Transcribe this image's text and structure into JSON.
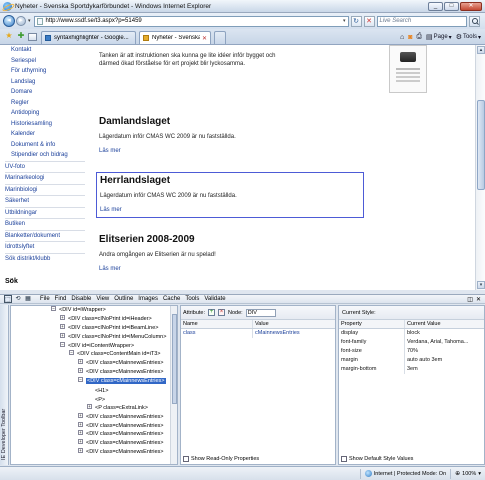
{
  "window": {
    "title": "Nyheter - Svenska Sportdykarförbundet - Windows Internet Explorer",
    "minimize": "_",
    "maximize": "□",
    "close": "✕"
  },
  "address": {
    "url": "http://www.ssdf.se/t3.aspx?p=51459",
    "search_placeholder": "Live Search"
  },
  "tabs": [
    {
      "label": "syntaxhighlighter - Google...",
      "active": false
    },
    {
      "label": "Nyheter - Svenska Spor...",
      "active": true
    }
  ],
  "command_bar": {
    "page": "Page",
    "tools": "Tools"
  },
  "sidebar": {
    "items": [
      {
        "label": "Kontakt",
        "sub": true
      },
      {
        "label": "Seriespel",
        "sub": true
      },
      {
        "label": "För uthyrning",
        "sub": true
      },
      {
        "label": "Landslag",
        "sub": true
      },
      {
        "label": "Domare",
        "sub": true
      },
      {
        "label": "Regler",
        "sub": true
      },
      {
        "label": "Antidoping",
        "sub": true
      },
      {
        "label": "Historiesamling",
        "sub": true
      },
      {
        "label": "Kalender",
        "sub": true
      },
      {
        "label": "Dokument & info",
        "sub": true
      },
      {
        "label": "Stipendier och bidrag",
        "sub": true
      },
      {
        "label": "UV-foto",
        "sub": false
      },
      {
        "label": "Marinarkeologi",
        "sub": false
      },
      {
        "label": "Marinbiologi",
        "sub": false
      },
      {
        "label": "Säkerhet",
        "sub": false
      },
      {
        "label": "Utbildningar",
        "sub": false
      },
      {
        "label": "Butiken",
        "sub": false
      },
      {
        "label": "Blanketter/dokument",
        "sub": false
      },
      {
        "label": "Idrottslyftet",
        "sub": false
      },
      {
        "label": "Sök distrikt/klubb",
        "sub": false
      }
    ],
    "search_title": "Sök",
    "search_button": "ok"
  },
  "content": {
    "intro": "Tanken är att instruktionen ska kunna ge lite idéer inför bygget och därmed ökad förståelse för ert projekt blir lyckosamma.",
    "articles": [
      {
        "title": "Damlandslaget",
        "body": "Lägerdatum inför CMAS WC 2009 är nu fastställda.",
        "more": "Läs mer"
      },
      {
        "title": "Herrlandslaget",
        "body": "Lägerdatum inför CMAS WC 2009 är nu fastställda.",
        "more": "Läs mer"
      },
      {
        "title": "Elitserien 2008-2009",
        "body": "Andra omgången av Elitserien är nu spelad!",
        "more": "Läs mer"
      }
    ]
  },
  "devtools": {
    "menu": [
      "File",
      "Find",
      "Disable",
      "View",
      "Outline",
      "Images",
      "Cache",
      "Tools",
      "Validate"
    ],
    "side_label": "IE Developer Toolbar",
    "tree": [
      {
        "indent": 0,
        "toggle": "−",
        "text": "<DIV id=iWrapper>"
      },
      {
        "indent": 1,
        "toggle": "+",
        "text": "<DIV class=cINoPrint id=iHeader>"
      },
      {
        "indent": 1,
        "toggle": "+",
        "text": "<DIV class=cINoPrint id=iBeamLine>"
      },
      {
        "indent": 1,
        "toggle": "+",
        "text": "<DIV class=cINoPrint id=iMenuColumn>"
      },
      {
        "indent": 1,
        "toggle": "−",
        "text": "<DIV id=iContentWrapper>"
      },
      {
        "indent": 2,
        "toggle": "−",
        "text": "<DIV class=cContentMain id=iT3>"
      },
      {
        "indent": 3,
        "toggle": "+",
        "text": "<DIV class=cMainnewsEntries>"
      },
      {
        "indent": 3,
        "toggle": "+",
        "text": "<DIV class=cMainnewsEntries>"
      },
      {
        "indent": 3,
        "toggle": "−",
        "text": "<DIV class=cMainnewsEntries>",
        "selected": true
      },
      {
        "indent": 4,
        "toggle": "",
        "text": "<H1>"
      },
      {
        "indent": 4,
        "toggle": "",
        "text": "<P>"
      },
      {
        "indent": 4,
        "toggle": "+",
        "text": "<P class=cExtraLink>"
      },
      {
        "indent": 3,
        "toggle": "+",
        "text": "<DIV class=cMainnewsEntries>"
      },
      {
        "indent": 3,
        "toggle": "+",
        "text": "<DIV class=cMainnewsEntries>"
      },
      {
        "indent": 3,
        "toggle": "+",
        "text": "<DIV class=cMainnewsEntries>"
      },
      {
        "indent": 3,
        "toggle": "+",
        "text": "<DIV class=cMainnewsEntries>"
      },
      {
        "indent": 3,
        "toggle": "+",
        "text": "<DIV class=cMainnewsEntries>"
      }
    ],
    "attributes": {
      "attribute_label": "Attribute:",
      "node_label": "Node:",
      "node_value": "DIV",
      "col_name": "Name",
      "col_value": "Value",
      "rows": [
        {
          "name": "class",
          "value": "cMainnewsEntries"
        }
      ],
      "show_readonly": "Show Read-Only Properties"
    },
    "style": {
      "header": "Current Style:",
      "col_property": "Property",
      "col_value": "Current Value",
      "rows": [
        {
          "property": "display",
          "value": "block"
        },
        {
          "property": "font-family",
          "value": "Verdana, Arial, Tahoma..."
        },
        {
          "property": "font-size",
          "value": "70%"
        },
        {
          "property": "margin",
          "value": "auto auto 3em"
        },
        {
          "property": "margin-bottom",
          "value": "3em"
        }
      ],
      "show_default": "Show Default Style Values"
    }
  },
  "status": {
    "zone": "Internet | Protected Mode: On",
    "zoom": "100%"
  }
}
